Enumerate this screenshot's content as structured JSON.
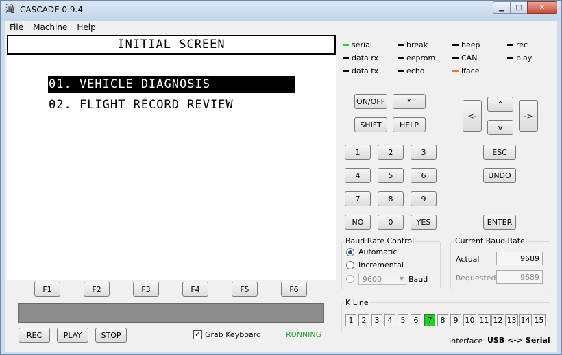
{
  "window": {
    "title": "CASCADE 0.9.4",
    "app_icon_glyph": "滝",
    "minimize_glyph": "▁",
    "maximize_glyph": "▢",
    "close_glyph": "✕"
  },
  "menu": [
    "File",
    "Machine",
    "Help"
  ],
  "screen": {
    "title": "INITIAL SCREEN",
    "lines": [
      "01. VEHICLE DIAGNOSIS",
      "02. FLIGHT RECORD REVIEW"
    ],
    "selected_line": 0
  },
  "function_keys": [
    "F1",
    "F2",
    "F3",
    "F4",
    "F5",
    "F6"
  ],
  "bottom_bar": {
    "rec": "REC",
    "play": "PLAY",
    "stop": "STOP",
    "grab_keyboard": "Grab Keyboard",
    "grab_keyboard_checked": true,
    "status": "RUNNING",
    "checkmark": "✓"
  },
  "indicators": [
    {
      "label": "serial",
      "state": "green"
    },
    {
      "label": "break",
      "state": "off"
    },
    {
      "label": "beep",
      "state": "off"
    },
    {
      "label": "rec",
      "state": "off"
    },
    {
      "label": "data rx",
      "state": "off"
    },
    {
      "label": "eeprom",
      "state": "off"
    },
    {
      "label": "CAN",
      "state": "off"
    },
    {
      "label": "play",
      "state": "off"
    },
    {
      "label": "data tx",
      "state": "off"
    },
    {
      "label": "echo",
      "state": "off"
    },
    {
      "label": "iface",
      "state": "orange"
    }
  ],
  "keypad": {
    "on_off": "ON/OFF",
    "star": "*",
    "shift": "SHIFT",
    "help": "HELP",
    "left": "<-",
    "up": "^",
    "down": "v",
    "right": "->",
    "digits": [
      "1",
      "2",
      "3",
      "4",
      "5",
      "6",
      "7",
      "8",
      "9"
    ],
    "no": "NO",
    "zero": "0",
    "yes": "YES",
    "esc": "ESC",
    "undo": "UNDO",
    "enter": "ENTER"
  },
  "baud_control": {
    "title": "Baud Rate Control",
    "automatic": "Automatic",
    "incremental": "Incremental",
    "selected": "Automatic",
    "rate_value": "9600",
    "baud_label": "Baud",
    "dropdown_glyph": "▼"
  },
  "current_baud": {
    "title": "Current Baud Rate",
    "actual_label": "Actual",
    "actual_value": "9689",
    "requested_label": "Requested",
    "requested_value": "9689"
  },
  "k_line": {
    "title": "K Line",
    "lines": [
      "1",
      "2",
      "3",
      "4",
      "5",
      "6",
      "7",
      "8",
      "9",
      "10",
      "11",
      "12",
      "13",
      "14",
      "15"
    ],
    "active": "7"
  },
  "statusbar": {
    "interface_label": "Interface",
    "interface_value": "USB <-> Serial"
  }
}
